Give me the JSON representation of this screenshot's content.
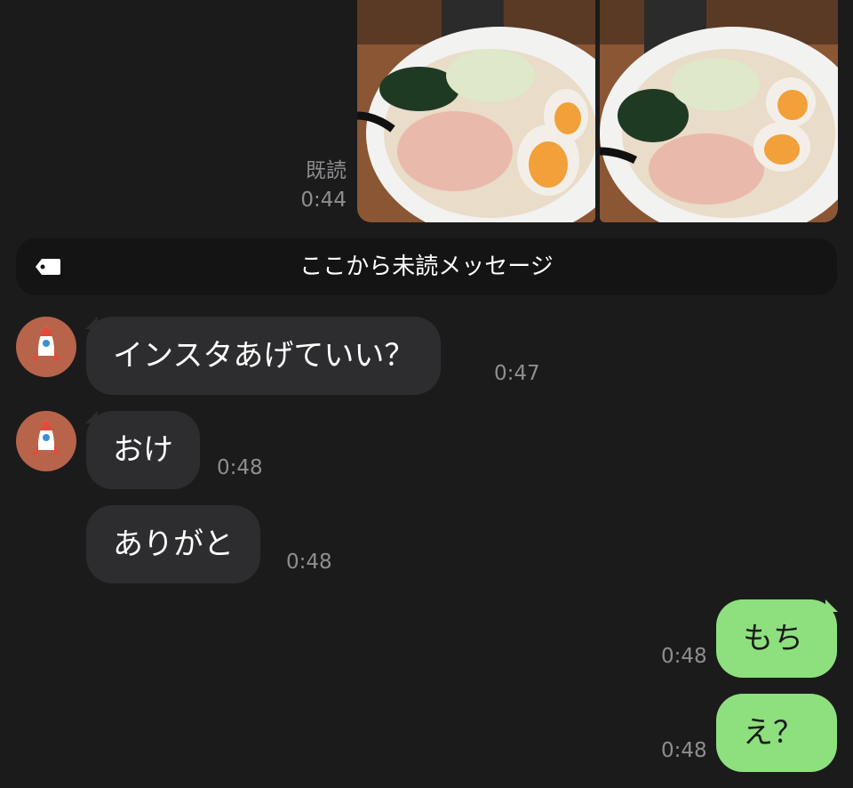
{
  "sent_photos": {
    "read_label": "既読",
    "time": "0:44"
  },
  "divider": {
    "label": "ここから未読メッセージ",
    "icon": "tag-icon"
  },
  "messages": [
    {
      "direction": "in",
      "text": "インスタあげていい？",
      "time": "0:47",
      "avatar": "rocket-icon"
    },
    {
      "direction": "in",
      "text": "おけ",
      "time": "0:48",
      "avatar": "rocket-icon"
    },
    {
      "direction": "in",
      "text": "ありがと",
      "time": "0:48"
    },
    {
      "direction": "out",
      "text": "もち",
      "time": "0:48"
    },
    {
      "direction": "out",
      "text": "え？",
      "time": "0:48"
    }
  ],
  "colors": {
    "background": "#1b1b1c",
    "incoming_bubble": "#2d2d2f",
    "outgoing_bubble": "#8ee07e",
    "avatar_bg": "#b8644a",
    "timestamp": "#8e8e90"
  }
}
